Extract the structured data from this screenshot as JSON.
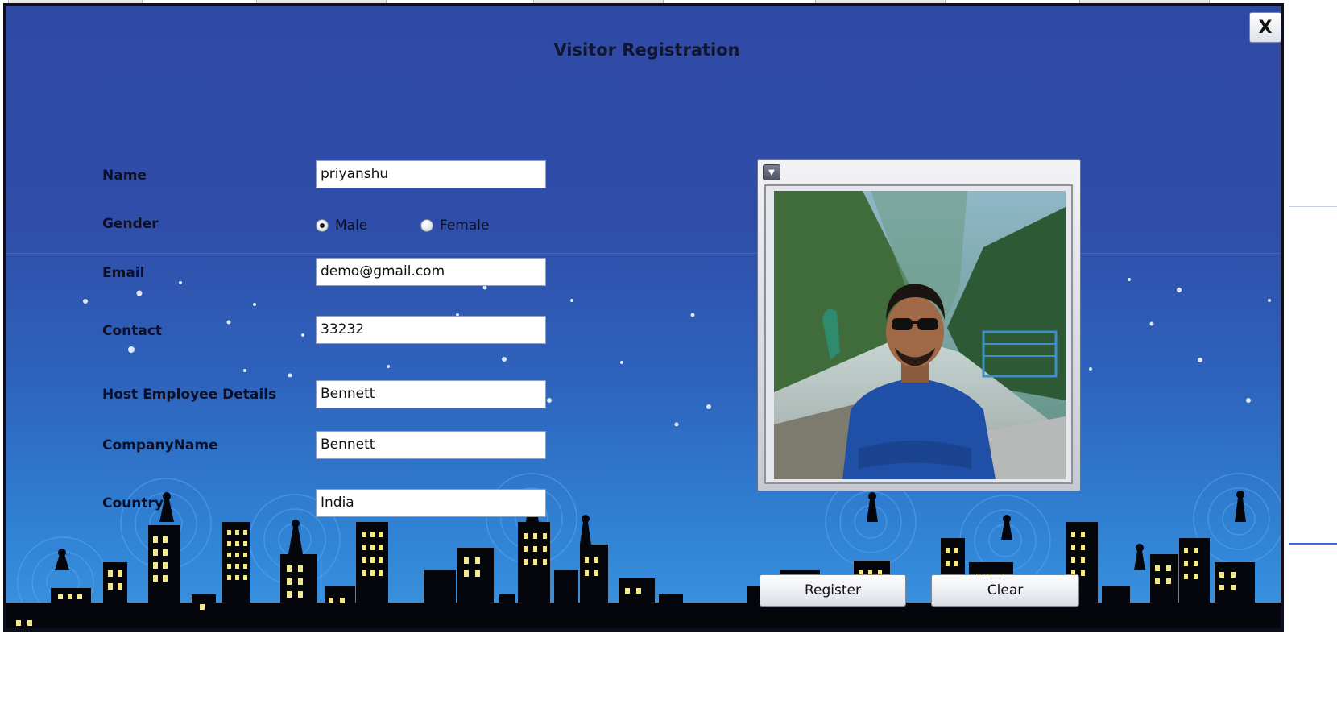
{
  "dialog": {
    "title": "Visitor Registration",
    "close_label": "X"
  },
  "form": {
    "name_label": "Name",
    "name_value": "priyanshu",
    "gender_label": "Gender",
    "gender_options": [
      "Male",
      "Female"
    ],
    "gender_selected": "Male",
    "email_label": "Email",
    "email_value": "demo@gmail.com",
    "contact_label": "Contact",
    "contact_value": "33232",
    "host_label": "Host Employee Details",
    "host_value": "Bennett",
    "company_label": "CompanyName",
    "company_value": "Bennett",
    "country_label": "Country",
    "country_value": "India"
  },
  "photo": {
    "menu_icon": "chevron-down-icon"
  },
  "actions": {
    "register_label": "Register",
    "clear_label": "Clear"
  },
  "colors": {
    "dialog_top": "#2f4aa5",
    "dialog_bottom": "#3b95e0",
    "skyline": "#05060c",
    "window_light": "#f4e88c"
  }
}
